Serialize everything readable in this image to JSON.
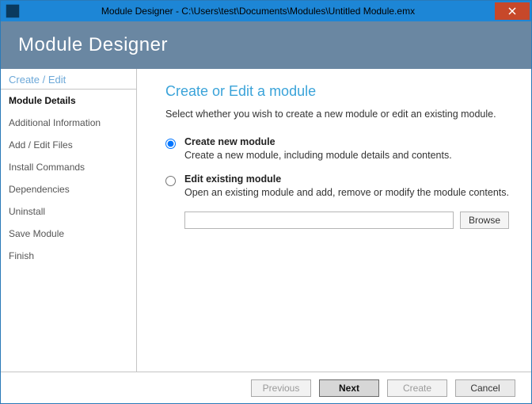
{
  "window": {
    "title": "Module Designer - C:\\Users\\test\\Documents\\Modules\\Untitled Module.emx"
  },
  "header": {
    "title": "Module Designer"
  },
  "sidebar": {
    "section": "Create / Edit",
    "items": [
      "Module Details",
      "Additional Information",
      "Add / Edit Files",
      "Install Commands",
      "Dependencies",
      "Uninstall",
      "Save Module",
      "Finish"
    ]
  },
  "main": {
    "heading": "Create or Edit a module",
    "intro": "Select whether you wish to create a new module or edit an existing module.",
    "option_create": {
      "title": "Create new module",
      "desc": "Create a new module, including module details and contents."
    },
    "option_edit": {
      "title": "Edit existing module",
      "desc": "Open an existing module and add, remove or modify the module contents."
    },
    "path_value": "",
    "browse_label": "Browse"
  },
  "footer": {
    "previous": "Previous",
    "next": "Next",
    "create": "Create",
    "cancel": "Cancel"
  }
}
